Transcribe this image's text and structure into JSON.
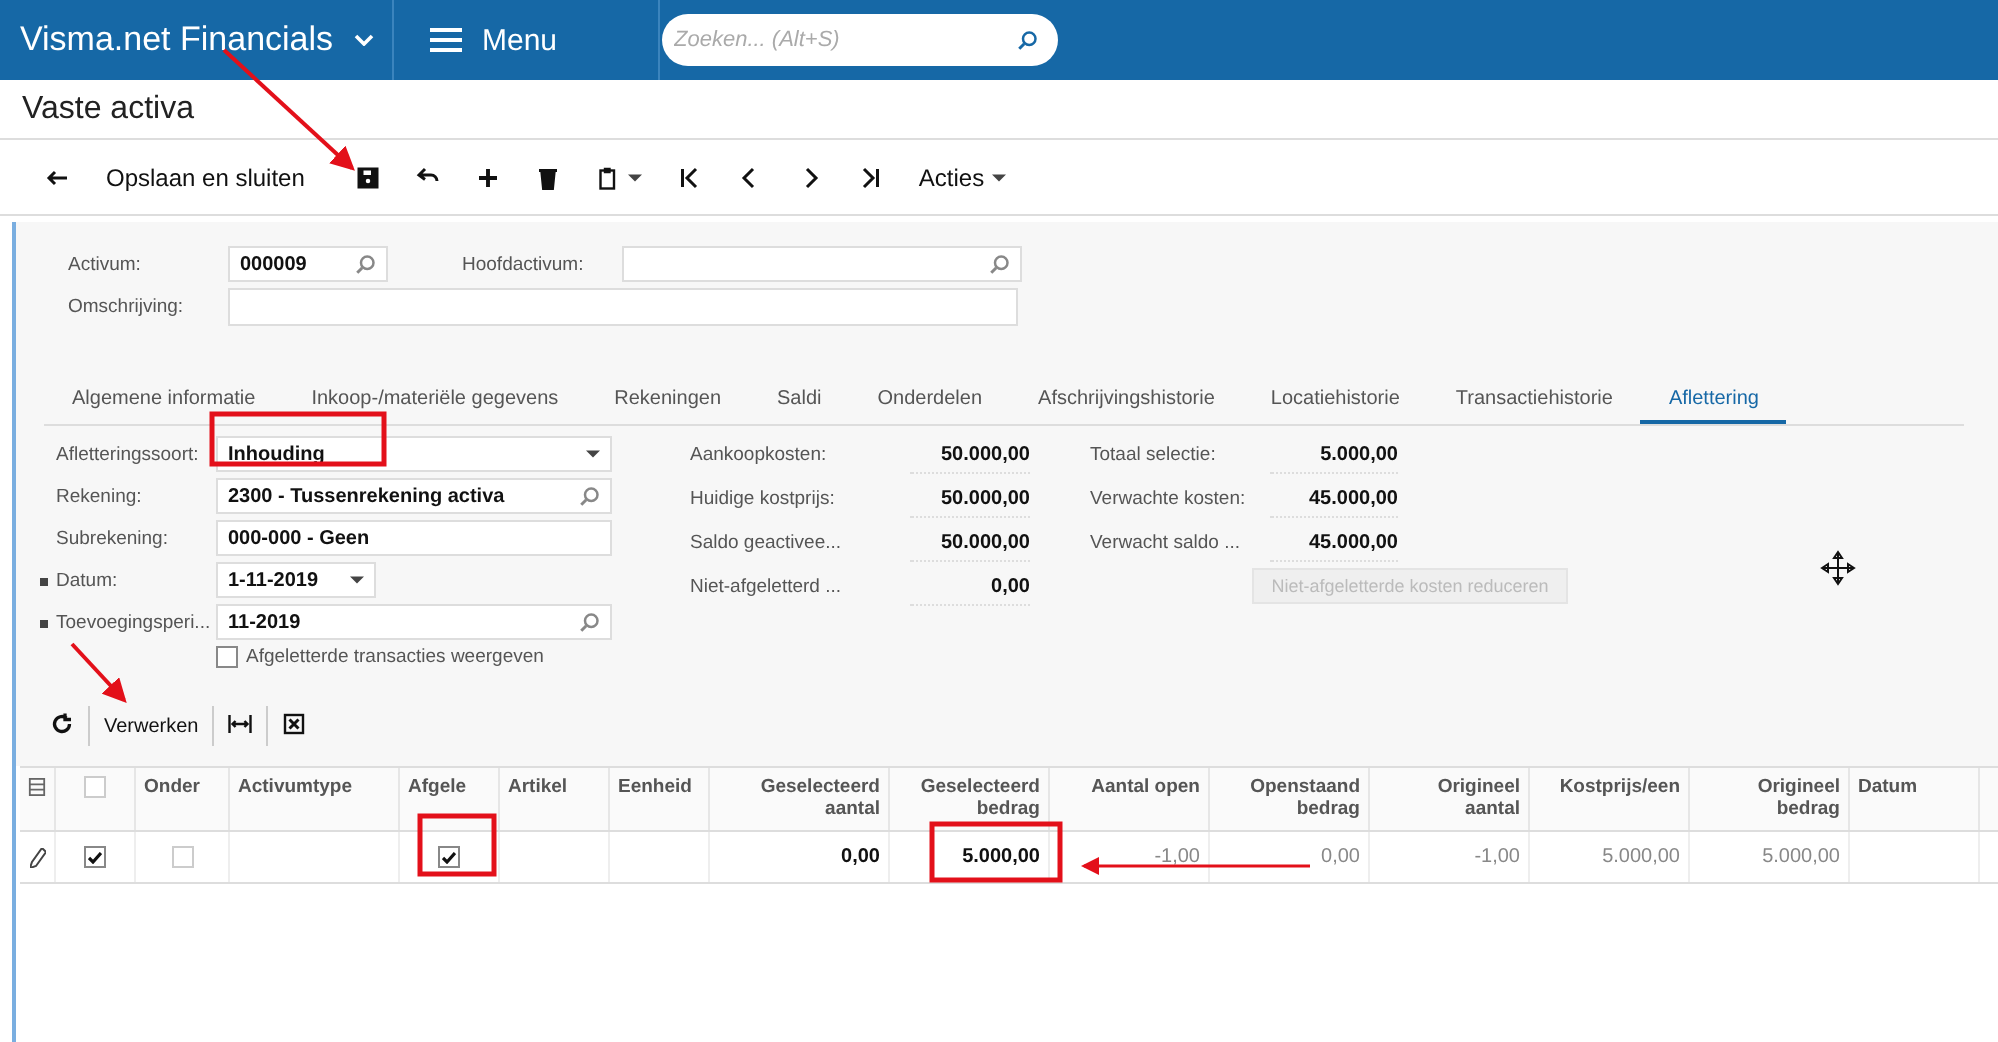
{
  "header": {
    "brand": "Visma.net Financials",
    "menu": "Menu",
    "search_placeholder": "Zoeken... (Alt+S)"
  },
  "page_title": "Vaste activa",
  "toolbar": {
    "save_close": "Opslaan en sluiten",
    "actions": "Acties"
  },
  "header_fields": {
    "asset": {
      "label": "Activum:",
      "value": "000009"
    },
    "parent_asset": {
      "label": "Hoofdactivum:"
    },
    "description": {
      "label": "Omschrijving:"
    }
  },
  "tabs": [
    {
      "label": "Algemene informatie",
      "selected": false
    },
    {
      "label": "Inkoop-/materiële gegevens",
      "selected": false
    },
    {
      "label": "Rekeningen",
      "selected": false
    },
    {
      "label": "Saldi",
      "selected": false
    },
    {
      "label": "Onderdelen",
      "selected": false
    },
    {
      "label": "Afschrijvingshistorie",
      "selected": false
    },
    {
      "label": "Locatiehistorie",
      "selected": false
    },
    {
      "label": "Transactiehistorie",
      "selected": false
    },
    {
      "label": "Aflettering",
      "selected": true
    }
  ],
  "fields": [
    {
      "label": "Afletteringssoort:",
      "value": "Inhouding",
      "kind": "select",
      "required": false
    },
    {
      "label": "Rekening:",
      "value": "2300 - Tussenrekening activa",
      "kind": "lookup",
      "required": false
    },
    {
      "label": "Subrekening:",
      "value": "000-000 - Geen",
      "kind": "text",
      "required": false
    },
    {
      "label": "Datum:",
      "value": "1-11-2019",
      "kind": "date",
      "required": true
    },
    {
      "label": "Toevoegingsperi...",
      "value": "11-2019",
      "kind": "lookup",
      "required": true
    }
  ],
  "show_matched": {
    "label": "Afgeletterde transacties weergeven",
    "checked": false
  },
  "summary_1": [
    {
      "label": "Aankoopkosten:",
      "value": "50.000,00"
    },
    {
      "label": "Huidige kostprijs:",
      "value": "50.000,00"
    },
    {
      "label": "Saldo geactivee...",
      "value": "50.000,00"
    },
    {
      "label": "Niet-afgeletterd ...",
      "value": "0,00"
    }
  ],
  "summary_2": [
    {
      "label": "Totaal selectie:",
      "value": "5.000,00"
    },
    {
      "label": "Verwachte kosten:",
      "value": "45.000,00"
    },
    {
      "label": "Verwacht saldo ...",
      "value": "45.000,00"
    }
  ],
  "reduce_button": {
    "label": "Niet-afgeletterde kosten reduceren",
    "disabled": true
  },
  "grid_toolbar": {
    "process": "Verwerken"
  },
  "grid": {
    "columns": [
      {
        "kind": "icon"
      },
      {
        "kind": "check",
        "checked": false
      },
      {
        "kind": "check",
        "label": "Onder"
      },
      {
        "kind": "text",
        "label": "Activumtype"
      },
      {
        "kind": "check",
        "label": "Afgele"
      },
      {
        "kind": "text",
        "label": "Artikel"
      },
      {
        "kind": "text",
        "label": "Eenheid"
      },
      {
        "kind": "num",
        "label": "Geselecteerd aantal",
        "editable": true
      },
      {
        "kind": "num",
        "label": "Geselecteerd bedrag",
        "editable": true
      },
      {
        "kind": "num",
        "label": "Aantal open",
        "editable": false
      },
      {
        "kind": "num",
        "label": "Openstaand bedrag",
        "editable": false
      },
      {
        "kind": "num",
        "label": "Origineel aantal",
        "editable": false
      },
      {
        "kind": "num",
        "label": "Kostprijs/een",
        "editable": false
      },
      {
        "kind": "num",
        "label": "Origineel bedrag",
        "editable": false
      },
      {
        "kind": "text",
        "label": "Datum"
      }
    ],
    "rows": [
      {
        "cells": [
          null,
          true,
          false,
          null,
          true,
          null,
          null,
          "0,00",
          "5.000,00",
          "-1,00",
          "0,00",
          "-1,00",
          "5.000,00",
          "5.000,00",
          null
        ]
      }
    ]
  }
}
